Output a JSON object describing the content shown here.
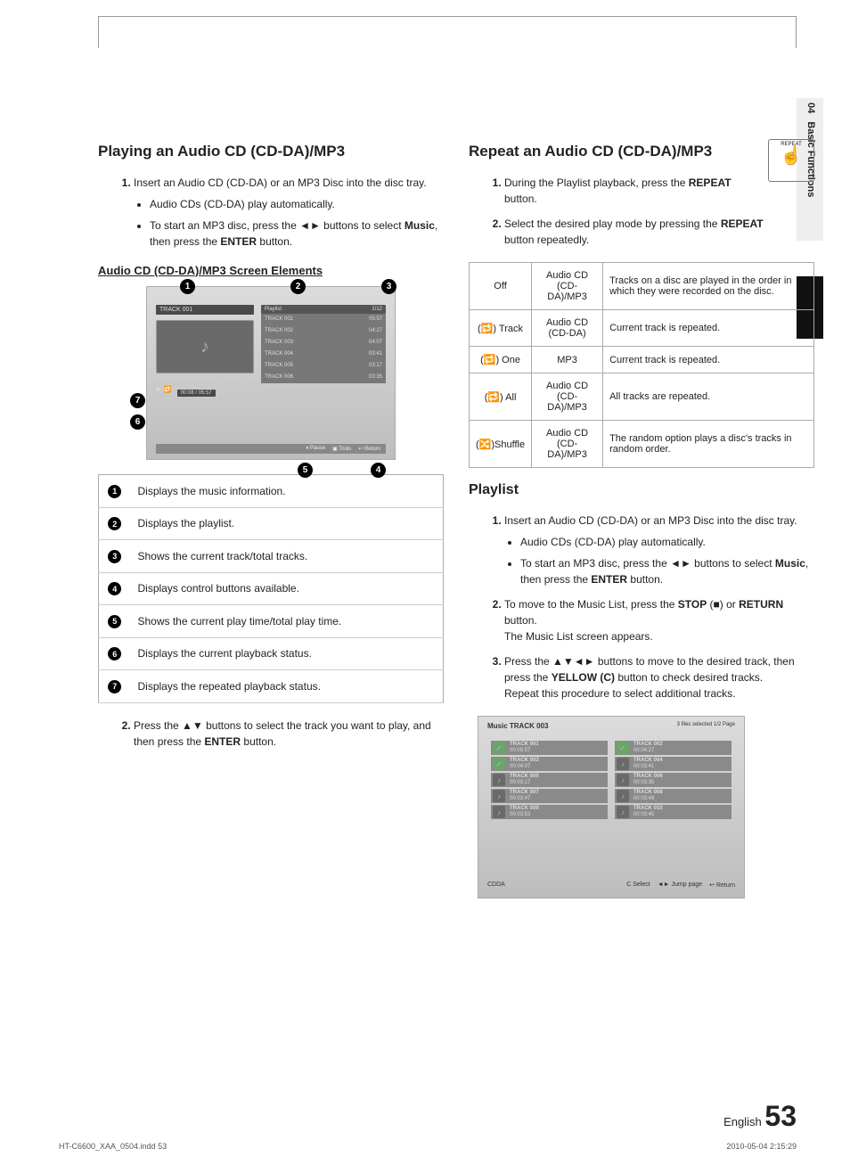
{
  "side": {
    "chapter": "04",
    "section": "Basic Functions"
  },
  "left": {
    "h1": "Playing an Audio CD (CD-DA)/MP3",
    "step1": "Insert an Audio CD (CD-DA) or an MP3 Disc into the disc tray.",
    "b1": "Audio CDs (CD-DA) play automatically.",
    "b2a": "To start an MP3 disc, press the ◄► buttons to select ",
    "b2b": "Music",
    "b2c": ", then press the ",
    "b2d": "ENTER",
    "b2e": " button.",
    "h2": "Audio CD (CD-DA)/MP3 Screen Elements",
    "ss": {
      "current_title": "TRACK 001",
      "time": "00:08 / 05:57",
      "play": "► 🔁",
      "header_l": "Playlist",
      "header_r": "1/12",
      "rows": [
        {
          "t": "TRACK 001",
          "d": "05:57"
        },
        {
          "t": "TRACK 002",
          "d": "04:27"
        },
        {
          "t": "TRACK 003",
          "d": "04:07"
        },
        {
          "t": "TRACK 004",
          "d": "03:41"
        },
        {
          "t": "TRACK 005",
          "d": "03:17"
        },
        {
          "t": "TRACK 006",
          "d": "03:35"
        }
      ],
      "f_pause": "⏸ Pause",
      "f_tools": "▣ Tools",
      "f_return": "↩ Return"
    },
    "legend": [
      "Displays the music information.",
      "Displays the playlist.",
      "Shows the current track/total tracks.",
      "Displays control buttons available.",
      "Shows the current play time/total play time.",
      "Displays the current playback status.",
      "Displays the repeated playback status."
    ],
    "step2a": "Press the ▲▼ buttons to select the track you want to play, and then press the ",
    "step2b": "ENTER",
    "step2c": " button."
  },
  "right": {
    "h1": "Repeat an Audio CD (CD-DA)/MP3",
    "repeat_label": "REPEAT",
    "s1a": "During the Playlist playback, press the ",
    "s1b": "REPEAT",
    "s1c": " button.",
    "s2a": "Select the desired play mode by pressing the ",
    "s2b": "REPEAT",
    "s2c": " button repeatedly.",
    "table": [
      {
        "m": "Off",
        "d": "Audio CD (CD-DA)/MP3",
        "e": "Tracks on a disc are played in the order in which they were recorded on the disc."
      },
      {
        "m": "(🔁) Track",
        "d": "Audio CD (CD-DA)",
        "e": "Current track is repeated."
      },
      {
        "m": "(🔁) One",
        "d": "MP3",
        "e": "Current track is repeated."
      },
      {
        "m": "(🔁) All",
        "d": "Audio CD (CD-DA)/MP3",
        "e": "All tracks are repeated."
      },
      {
        "m": "(🔀)Shuffle",
        "d": "Audio CD (CD-DA)/MP3",
        "e": "The random option plays a disc's tracks in random order."
      }
    ],
    "h2": "Playlist",
    "p1": "Insert an Audio CD (CD-DA) or an MP3 Disc into the disc tray.",
    "pb1": "Audio CDs (CD-DA) play automatically.",
    "pb2a": "To start an MP3 disc, press the ◄► buttons to select ",
    "pb2b": "Music",
    "pb2c": ", then press the ",
    "pb2d": "ENTER",
    "pb2e": " button.",
    "p2a": "To move to the Music List, press the ",
    "p2b": "STOP",
    "p2c": " (■) or ",
    "p2d": "RETURN",
    "p2e": " button.",
    "p2f": "The Music List screen appears.",
    "p3a": "Press the ▲▼◄► buttons to move to the desired track, then press the ",
    "p3b": "YELLOW (C)",
    "p3c": " button to check desired tracks.",
    "p3d": "Repeat this procedure to select additional tracks.",
    "ss2": {
      "head_l": "Music   TRACK 003",
      "head_r": "3 files selected   1/2 Page",
      "items": [
        {
          "t": "TRACK 001",
          "d": "00:05:57",
          "sel": true
        },
        {
          "t": "TRACK 002",
          "d": "00:04:27",
          "sel": true
        },
        {
          "t": "TRACK 003",
          "d": "00:04:07",
          "sel": true
        },
        {
          "t": "TRACK 004",
          "d": "00:03:41",
          "sel": false
        },
        {
          "t": "TRACK 005",
          "d": "00:03:17",
          "sel": false
        },
        {
          "t": "TRACK 006",
          "d": "00:03:35",
          "sel": false
        },
        {
          "t": "TRACK 007",
          "d": "00:03:47",
          "sel": false
        },
        {
          "t": "TRACK 008",
          "d": "00:03:49",
          "sel": false
        },
        {
          "t": "TRACK 009",
          "d": "00:03:53",
          "sel": false
        },
        {
          "t": "TRACK 010",
          "d": "00:03:45",
          "sel": false
        }
      ],
      "foot_l": "CDDA",
      "f1": "C Select",
      "f2": "◄► Jump page",
      "f3": "↩ Return"
    }
  },
  "footer": {
    "lang": "English",
    "page": "53",
    "indd": "HT-C6600_XAA_0504.indd   53",
    "ts": "2010-05-04   2:15:29"
  }
}
